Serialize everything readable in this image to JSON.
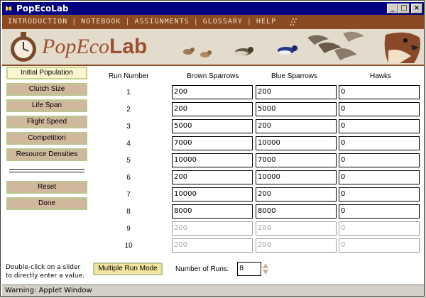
{
  "window": {
    "title": "PopEcoLab",
    "minimize_glyph": "_",
    "maximize_glyph": "□",
    "close_glyph": "×"
  },
  "menu": {
    "items": [
      "INTRODUCTION",
      "NOTEBOOK",
      "ASSIGNMENTS",
      "GLOSSARY",
      "HELP"
    ],
    "separator": "|"
  },
  "banner": {
    "logo_part1": "PopEco",
    "logo_part2": "Lab"
  },
  "sidebar": {
    "buttons": [
      {
        "label": "Initial Population",
        "active": true
      },
      {
        "label": "Clutch Size",
        "active": false
      },
      {
        "label": "Life Span",
        "active": false
      },
      {
        "label": "Flight Speed",
        "active": false
      },
      {
        "label": "Competition",
        "active": false
      },
      {
        "label": "Resource Densities",
        "active": false
      }
    ],
    "reset_label": "Reset",
    "done_label": "Done"
  },
  "table": {
    "headers": [
      "Run Number",
      "Brown Sparrows",
      "Blue Sparrows",
      "Hawks"
    ],
    "rows": [
      {
        "run": "1",
        "brown": "200",
        "blue": "200",
        "hawks": "0",
        "enabled": true
      },
      {
        "run": "2",
        "brown": "200",
        "blue": "5000",
        "hawks": "0",
        "enabled": true
      },
      {
        "run": "3",
        "brown": "5000",
        "blue": "200",
        "hawks": "0",
        "enabled": true
      },
      {
        "run": "4",
        "brown": "7000",
        "blue": "10000",
        "hawks": "0",
        "enabled": true
      },
      {
        "run": "5",
        "brown": "10000",
        "blue": "7000",
        "hawks": "0",
        "enabled": true
      },
      {
        "run": "6",
        "brown": "200",
        "blue": "10000",
        "hawks": "0",
        "enabled": true
      },
      {
        "run": "7",
        "brown": "10000",
        "blue": "200",
        "hawks": "0",
        "enabled": true
      },
      {
        "run": "8",
        "brown": "8000",
        "blue": "8000",
        "hawks": "0",
        "enabled": true
      },
      {
        "run": "9",
        "brown": "200",
        "blue": "200",
        "hawks": "0",
        "enabled": false
      },
      {
        "run": "10",
        "brown": "200",
        "blue": "200",
        "hawks": "0",
        "enabled": false
      }
    ]
  },
  "footer": {
    "hint_line1": "Double-click on a slider",
    "hint_line2": "to directly enter a value.",
    "multiple_run_mode_label": "Multiple Run Mode",
    "number_of_runs_label": "Number of Runs:",
    "number_of_runs_value": "8"
  },
  "status": {
    "text": "Warning: Applet Window"
  },
  "colors": {
    "titlebar": "#000080",
    "menubar": "#8b4a22",
    "banner": "#e3dccd",
    "logo_text": "#9c5030",
    "button": "#d0b89c",
    "button_active": "#fbf6cf",
    "multiple_run_mode": "#f2e6a0"
  }
}
